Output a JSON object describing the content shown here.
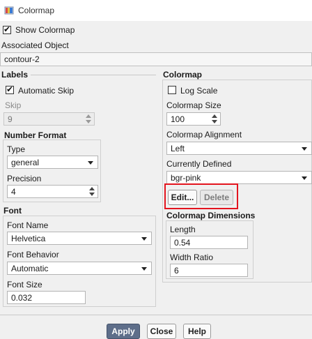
{
  "window": {
    "title": "Colormap",
    "icon": "colormap-app-icon"
  },
  "show_colormap": {
    "label": "Show Colormap",
    "checked": true
  },
  "associated_object": {
    "label": "Associated Object",
    "value": "contour-2"
  },
  "labels": {
    "heading": "Labels",
    "automatic_skip": {
      "label": "Automatic Skip",
      "checked": true
    },
    "skip": {
      "label": "Skip",
      "value": "9"
    },
    "number_format": {
      "heading": "Number Format",
      "type_label": "Type",
      "type_value": "general",
      "precision_label": "Precision",
      "precision_value": "4"
    }
  },
  "font": {
    "heading": "Font",
    "name_label": "Font Name",
    "name_value": "Helvetica",
    "behavior_label": "Font Behavior",
    "behavior_value": "Automatic",
    "size_label": "Font Size",
    "size_value": "0.032"
  },
  "colormap": {
    "heading": "Colormap",
    "log_scale": {
      "label": "Log Scale",
      "checked": false
    },
    "size_label": "Colormap Size",
    "size_value": "100",
    "alignment_label": "Colormap Alignment",
    "alignment_value": "Left",
    "defined_label": "Currently Defined",
    "defined_value": "bgr-pink",
    "edit_label": "Edit...",
    "delete_label": "Delete",
    "dimensions": {
      "heading": "Colormap Dimensions",
      "length_label": "Length",
      "length_value": "0.54",
      "width_label": "Width Ratio",
      "width_value": "6"
    }
  },
  "buttons": {
    "apply": "Apply",
    "close": "Close",
    "help": "Help"
  },
  "colors": {
    "highlight": "#e3141e",
    "primary_button": "#5e6e8a"
  }
}
